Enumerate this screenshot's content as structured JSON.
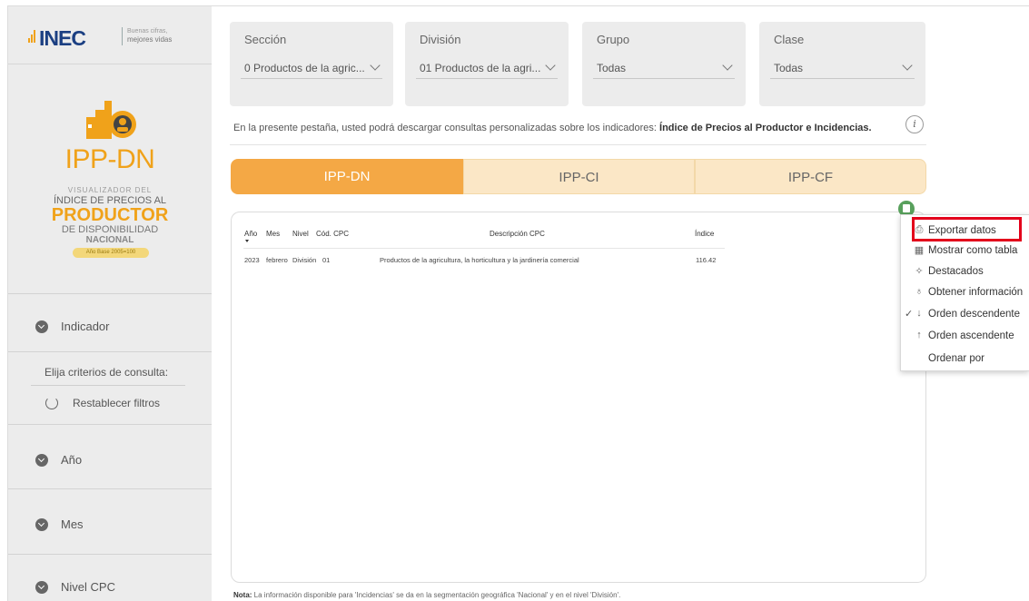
{
  "brand": {
    "inec": "INEC",
    "tagline_1": "Buenas cifras,",
    "tagline_2": "mejores vidas",
    "title": "IPP-DN",
    "sub_1": "VISUALIZADOR DEL",
    "sub_2": "ÍNDICE DE PRECIOS AL",
    "sub_3": "PRODUCTOR",
    "sub_4": "DE DISPONIBILIDAD",
    "sub_5": "NACIONAL",
    "base": "Año Base 2005=100"
  },
  "sidebar": {
    "indicador": "Indicador",
    "criteria": "Elija criterios de consulta:",
    "reset": "Restablecer filtros",
    "items": [
      "Año",
      "Mes",
      "Nivel CPC"
    ]
  },
  "filters": [
    {
      "title": "Sección",
      "value": "0 Productos de la agric..."
    },
    {
      "title": "División",
      "value": "01 Productos de la agri..."
    },
    {
      "title": "Grupo",
      "value": "Todas"
    },
    {
      "title": "Clase",
      "value": "Todas"
    }
  ],
  "info": {
    "text": "En la presente pestaña, usted podrá descargar consultas personalizadas sobre los indicadores: ",
    "bold": "Índice de Precios al Productor e Incidencias.",
    "icon": "i"
  },
  "tabs": [
    "IPP-DN",
    "IPP-CI",
    "IPP-CF"
  ],
  "table": {
    "headers": [
      "Año",
      "Mes",
      "Nivel",
      "Cód. CPC",
      "Descripción CPC",
      "Índice"
    ],
    "rows": [
      [
        "2023",
        "febrero",
        "División",
        "01",
        "Productos de la agricultura, la horticultura y la jardinería comercial",
        "116.42"
      ]
    ]
  },
  "menu": {
    "items": [
      {
        "icon": "export-icon",
        "glyph": "⎙",
        "label": "Exportar datos"
      },
      {
        "icon": "table-icon",
        "glyph": "▦",
        "label": "Mostrar como tabla"
      },
      {
        "icon": "spotlight-icon",
        "glyph": "✧",
        "label": "Destacados"
      },
      {
        "icon": "lightbulb-icon",
        "glyph": "♁",
        "label": "Obtener información"
      },
      {
        "icon": "sort-desc-icon",
        "glyph": "↓",
        "label": "Orden descendente",
        "checked": "✓"
      },
      {
        "icon": "sort-asc-icon",
        "glyph": "↑",
        "label": "Orden ascendente"
      },
      {
        "icon": "",
        "glyph": "",
        "label": "Ordenar por"
      }
    ]
  },
  "note": {
    "bold": "Nota:",
    "text": " La información disponible para 'Incidencias' se da en la segmentación geográfica 'Nacional' y en el nivel 'División'."
  },
  "colors": {
    "accent": "#f4a845",
    "tab_inactive": "#fbe7c6",
    "highlight": "#e3001b",
    "brand_blue": "#1b3f82"
  }
}
